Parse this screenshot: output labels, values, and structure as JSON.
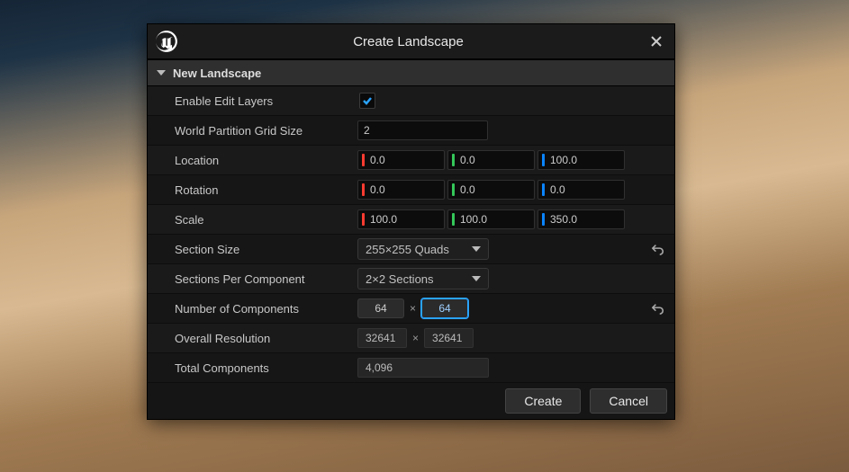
{
  "dialog": {
    "title": "Create Landscape",
    "section": "New Landscape"
  },
  "fields": {
    "enable_edit_layers": {
      "label": "Enable Edit Layers",
      "checked": true
    },
    "world_partition": {
      "label": "World Partition Grid Size",
      "value": "2"
    },
    "location": {
      "label": "Location",
      "x": "0.0",
      "y": "0.0",
      "z": "100.0"
    },
    "rotation": {
      "label": "Rotation",
      "x": "0.0",
      "y": "0.0",
      "z": "0.0"
    },
    "scale": {
      "label": "Scale",
      "x": "100.0",
      "y": "100.0",
      "z": "350.0"
    },
    "section_size": {
      "label": "Section Size",
      "value": "255×255 Quads"
    },
    "sections_per_component": {
      "label": "Sections Per Component",
      "value": "2×2 Sections"
    },
    "num_components": {
      "label": "Number of Components",
      "x": "64",
      "y": "64"
    },
    "overall_resolution": {
      "label": "Overall Resolution",
      "x": "32641",
      "y": "32641"
    },
    "total_components": {
      "label": "Total Components",
      "value": "4,096"
    }
  },
  "buttons": {
    "create": "Create",
    "cancel": "Cancel"
  }
}
